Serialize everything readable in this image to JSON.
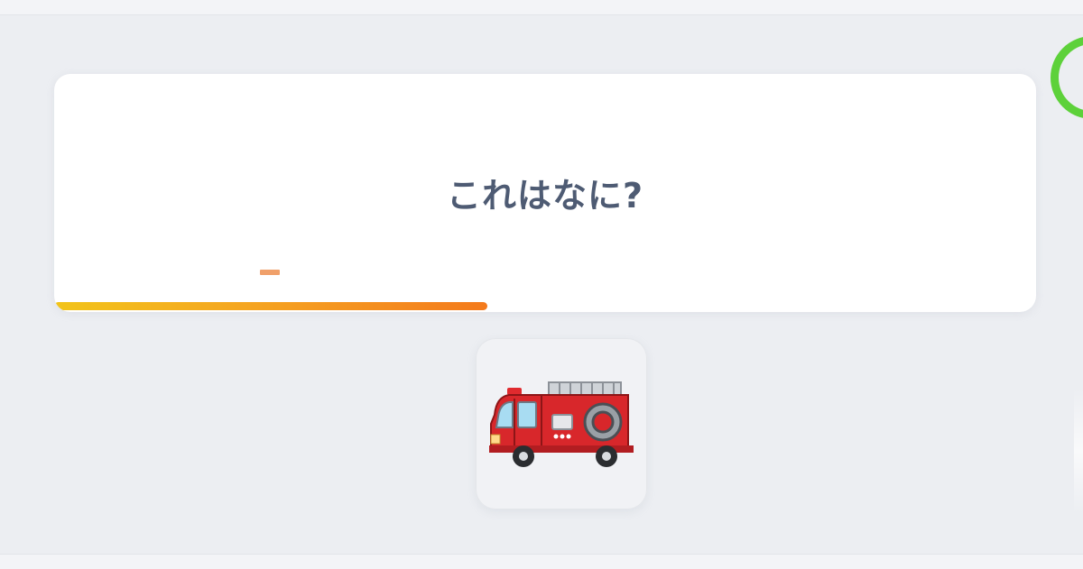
{
  "question": {
    "text": "これはなに?"
  },
  "progress": {
    "fraction": 0.441
  },
  "timer": {
    "color": "#5dd13a"
  },
  "answer_options": [
    {
      "icon": "fire-truck-icon"
    }
  ],
  "colors": {
    "question_text": "#4e5b73",
    "progress_start": "#f2c41a",
    "progress_end": "#f47a1c",
    "fire_truck_red": "#d8272b"
  }
}
